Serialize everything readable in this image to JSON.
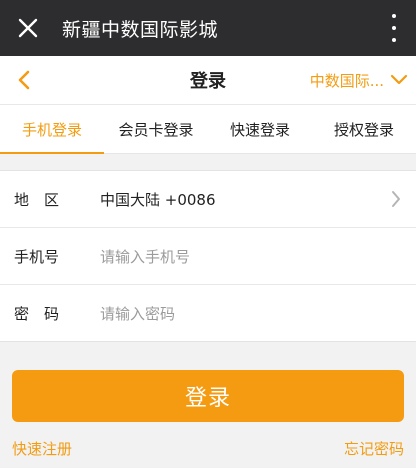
{
  "app": {
    "title": "新疆中数国际影城"
  },
  "nav": {
    "title": "登录",
    "cinema_name": "中数国际..."
  },
  "tabs": [
    {
      "label": "手机登录",
      "active": true
    },
    {
      "label": "会员卡登录",
      "active": false
    },
    {
      "label": "快速登录",
      "active": false
    },
    {
      "label": "授权登录",
      "active": false
    }
  ],
  "form": {
    "region_label": "地　区",
    "region_value": "中国大陆 +0086",
    "phone_label": "手机号",
    "phone_placeholder": "请输入手机号",
    "password_label": "密　码",
    "password_placeholder": "请输入密码"
  },
  "buttons": {
    "login": "登录"
  },
  "links": {
    "register": "快速注册",
    "forgot": "忘记密码"
  },
  "colors": {
    "accent": "#f39c12",
    "topbar": "#2d2d2f",
    "background": "#f2f2f2"
  },
  "icons": {
    "close": "close-icon",
    "more": "more-vertical-icon",
    "back": "chevron-left-icon",
    "dropdown": "chevron-down-icon",
    "row_arrow": "chevron-right-icon"
  }
}
